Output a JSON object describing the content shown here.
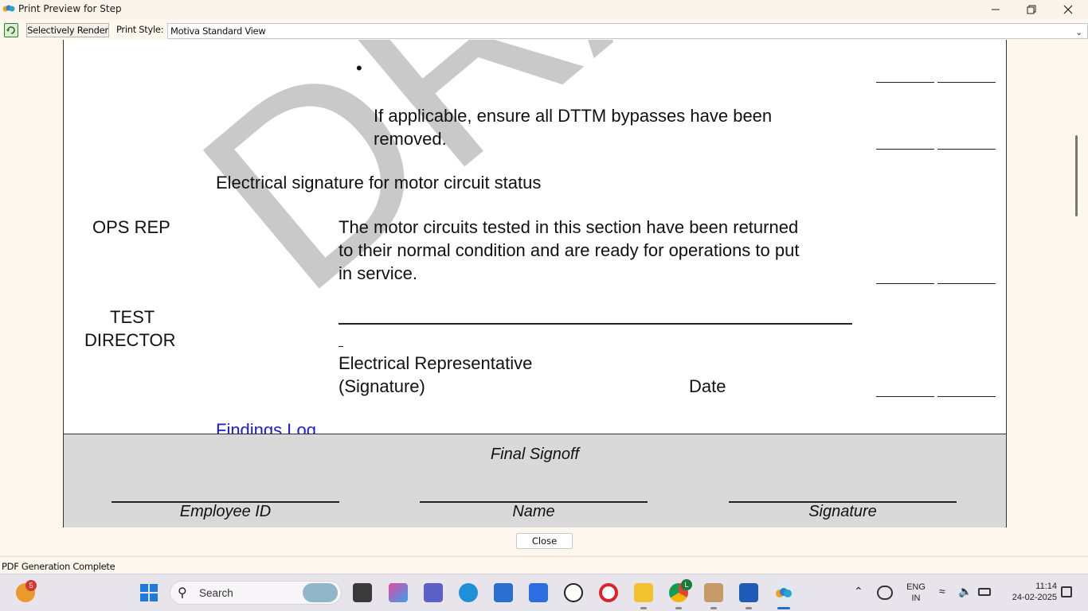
{
  "window": {
    "title": "Print Preview for Step"
  },
  "toolbar": {
    "selectively_render": "Selectively Render",
    "print_style_label": "Print Style:",
    "print_style_value": "Motiva Standard View"
  },
  "document": {
    "watermark": "DRAFT",
    "bullet_line_1": "If applicable, ensure all DTTM bypasses have been",
    "bullet_line_2": "removed.",
    "section_heading": "Electrical signature for motor circuit status",
    "ops_rep_label": "OPS REP",
    "ops_line_1": "The motor circuits tested in this section have been returned",
    "ops_line_2": "to their normal condition and are ready for operations to put",
    "ops_line_3": "in service.",
    "test_director_line_1": "TEST",
    "test_director_line_2": "DIRECTOR",
    "electrical_rep": "Electrical Representative",
    "signature_paren": "(Signature)",
    "date_label": "Date",
    "findings_log": "Findings Log"
  },
  "signoff": {
    "title": "Final Signoff",
    "employee_id": "Employee ID",
    "name": "Name",
    "signature": "Signature"
  },
  "footer": {
    "close_button": "Close",
    "status": "PDF Generation Complete"
  },
  "taskbar": {
    "search_placeholder": "Search",
    "weather_badge": "5",
    "chrome_badge": "L",
    "language_line_1": "ENG",
    "language_line_2": "IN",
    "time": "11:14",
    "date": "24-02-2025",
    "icons": [
      "weather-icon",
      "start-icon",
      "search-icon",
      "task-view-icon",
      "copilot-icon",
      "teams-icon",
      "edge-icon",
      "store-icon",
      "power-automate-icon",
      "dell-icon",
      "opera-icon",
      "file-explorer-icon",
      "chrome-icon",
      "contacts-icon",
      "word-icon",
      "app-icon"
    ]
  }
}
